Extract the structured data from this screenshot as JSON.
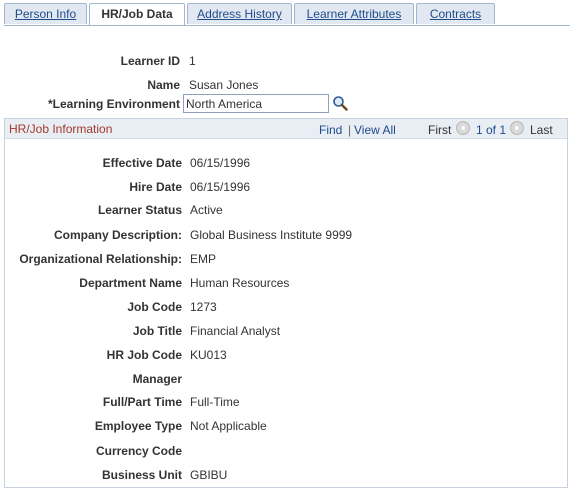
{
  "tabs": [
    {
      "label": "Person Info"
    },
    {
      "label": "HR/Job Data"
    },
    {
      "label": "Address History"
    },
    {
      "label": "Learner Attributes"
    },
    {
      "label": "Contracts"
    }
  ],
  "top_fields": {
    "learner_id_label": "Learner ID",
    "learner_id_value": "1",
    "name_label": "Name",
    "name_value": "Susan Jones",
    "learning_env_label": "*Learning Environment",
    "learning_env_value": "North America"
  },
  "section": {
    "title": "HR/Job Information",
    "find": "Find",
    "separator": "|",
    "view_all": "View All",
    "first": "First",
    "range": "1 of 1",
    "last": "Last"
  },
  "fields": [
    {
      "label": "Effective Date",
      "value": "06/15/1996"
    },
    {
      "label": "Hire Date",
      "value": "06/15/1996"
    },
    {
      "label": "Learner Status",
      "value": "Active"
    },
    {
      "label": "Company Description:",
      "value": "Global Business Institute 9999"
    },
    {
      "label": "Organizational Relationship:",
      "value": "EMP"
    },
    {
      "label": "Department Name",
      "value": "Human Resources"
    },
    {
      "label": "Job Code",
      "value": "1273"
    },
    {
      "label": "Job Title",
      "value": "Financial Analyst"
    },
    {
      "label": "HR Job Code",
      "value": "KU013"
    },
    {
      "label": "Manager",
      "value": ""
    },
    {
      "label": "Full/Part Time",
      "value": "Full-Time"
    },
    {
      "label": "Employee Type",
      "value": "Not Applicable"
    },
    {
      "label": "Currency Code",
      "value": ""
    },
    {
      "label": "Business Unit",
      "value": "GBIBU"
    }
  ],
  "icons": {
    "lookup": "magnifier-icon",
    "prev": "previous-arrow-icon",
    "next": "next-arrow-icon"
  }
}
